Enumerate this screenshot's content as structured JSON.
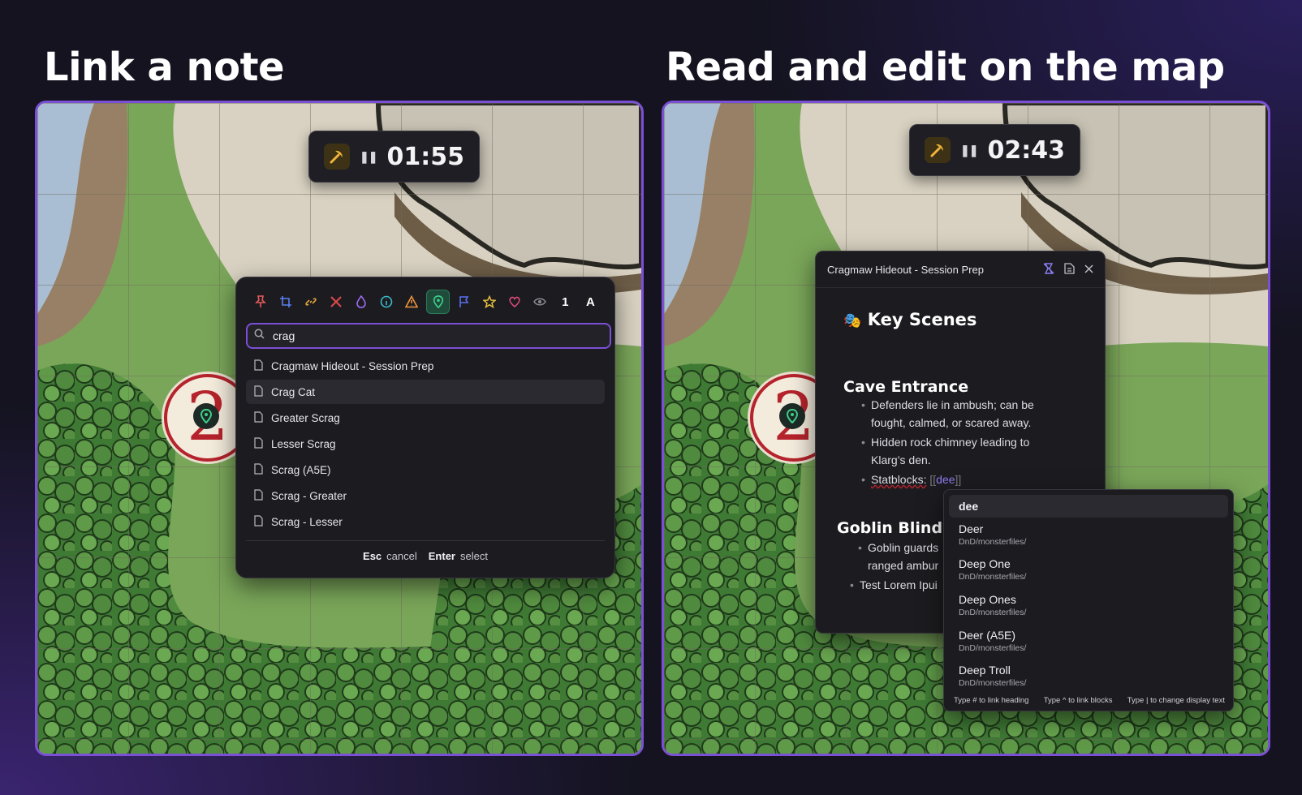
{
  "left": {
    "heading": "Link a note",
    "timer": {
      "time": "01:55",
      "pause_icon": "pause-icon",
      "pick_icon": "pickaxe-icon"
    },
    "marker_number": "2",
    "toolbar_icons": [
      "pin-icon",
      "crop-icon",
      "link-icon",
      "skull-icon",
      "droplet-icon",
      "info-icon",
      "warning-icon",
      "map-pin-icon",
      "flag-icon",
      "star-icon",
      "heart-icon",
      "eye-icon"
    ],
    "toolbar_text": {
      "one": "1",
      "a": "A"
    },
    "search": {
      "value": "crag"
    },
    "results": [
      "Cragmaw Hideout - Session Prep",
      "Crag Cat",
      "Greater Scrag",
      "Lesser Scrag",
      "Scrag (A5E)",
      "Scrag - Greater",
      "Scrag - Lesser"
    ],
    "hint": {
      "esc": "Esc",
      "esc_action": "cancel",
      "enter": "Enter",
      "enter_action": "select"
    },
    "colors": {
      "accent": "#7b4fd6",
      "marker_red": "#b5232c"
    }
  },
  "right": {
    "heading": "Read and edit on the map",
    "timer": {
      "time": "02:43"
    },
    "marker_number": "2",
    "note": {
      "title": "Cragmaw Hideout - Session Prep",
      "h1": "Key Scenes",
      "h1_icon": "theater-masks-icon",
      "section1": "Cave Entrance",
      "b1": "Defenders lie in ambush; can be",
      "b1b": "fought, calmed, or scared away.",
      "b2": "Hidden rock chimney leading to",
      "b2b": "Klarg’s den.",
      "b3_label": "Statblocks:",
      "b3_open": "[[",
      "b3_link": "dee",
      "b3_close": "]]",
      "section2": "Goblin Blind Ar",
      "b4": "Goblin guards",
      "b4b": "ranged ambur",
      "b5": "Test Lorem Ipui"
    },
    "suggest": {
      "query": "dee",
      "items": [
        {
          "name": "Deer",
          "path": "DnD/monsterfiles/"
        },
        {
          "name": "Deep One",
          "path": "DnD/monsterfiles/"
        },
        {
          "name": "Deep Ones",
          "path": "DnD/monsterfiles/"
        },
        {
          "name": "Deer (A5E)",
          "path": "DnD/monsterfiles/"
        },
        {
          "name": "Deep Troll",
          "path": "DnD/monsterfiles/"
        }
      ],
      "footer": [
        "Type # to link heading",
        "Type ^ to link blocks",
        "Type | to change display text"
      ]
    }
  }
}
